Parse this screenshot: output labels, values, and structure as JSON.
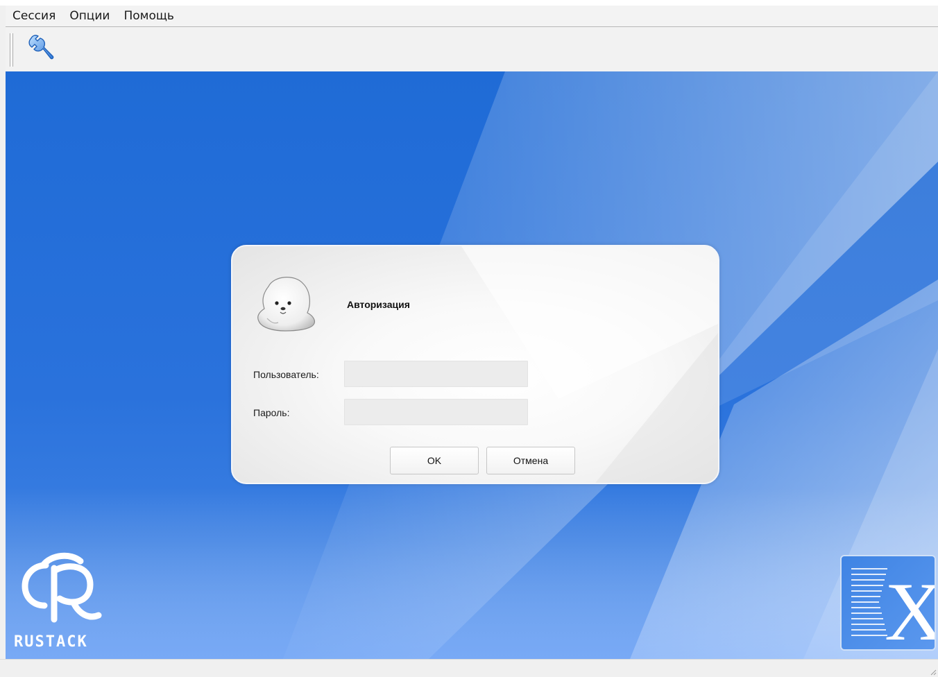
{
  "menu": {
    "items": [
      {
        "label": "Сессия"
      },
      {
        "label": "Опции"
      },
      {
        "label": "Помощь"
      }
    ]
  },
  "toolbar": {
    "settings_icon": "wrench-icon"
  },
  "dialog": {
    "title": "Авторизация",
    "user_label": "Пользователь:",
    "user_value": "",
    "password_label": "Пароль:",
    "password_value": "",
    "ok_label": "OK",
    "cancel_label": "Отмена",
    "avatar_icon": "seal-icon"
  },
  "branding": {
    "left_logo_text": "RUSTACK",
    "right_logo_icon": "x-logo-icon"
  },
  "colors": {
    "desktop_blue": "#1f6bd6",
    "menu_bg": "#f3f3f3",
    "dialog_bg": "#ffffff",
    "field_bg": "#ececec"
  }
}
